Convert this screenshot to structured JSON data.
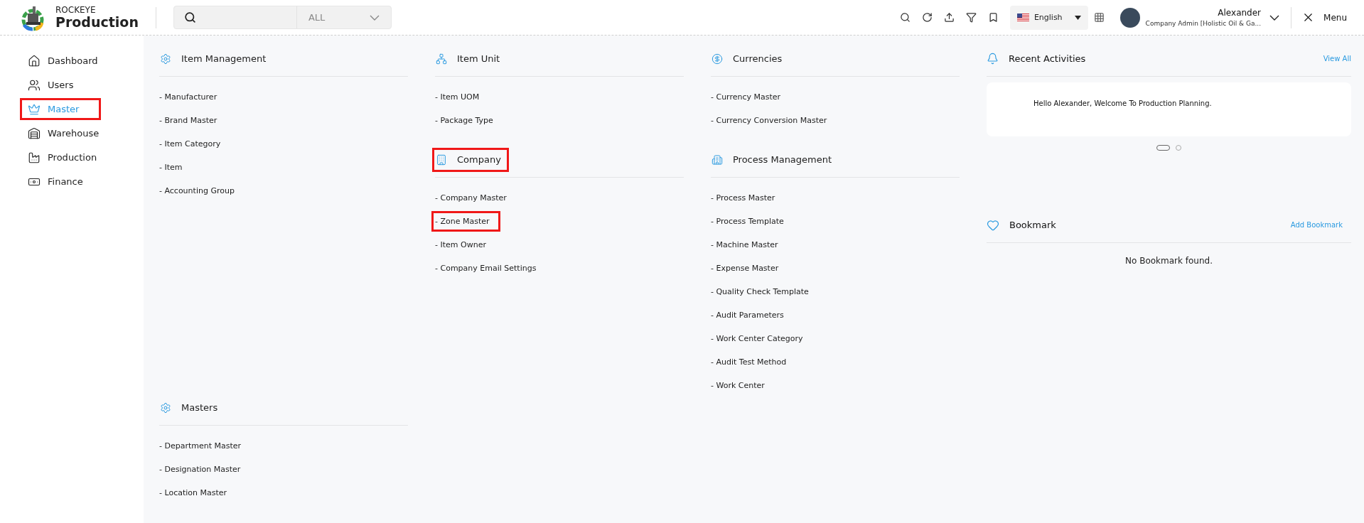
{
  "header": {
    "brand_top": "ROCKEYE",
    "brand_name": "Production",
    "search": {
      "scope": "ALL"
    },
    "language": "English",
    "user": {
      "name": "Alexander",
      "role": "Company Admin [Holistic Oil & Ga..."
    },
    "menu_label": "Menu"
  },
  "sidebar": {
    "items": [
      {
        "kind": "home",
        "label": "Dashboard",
        "selected": false,
        "highlighted": false
      },
      {
        "kind": "users",
        "label": "Users",
        "selected": false,
        "highlighted": false
      },
      {
        "kind": "crown",
        "label": "Master",
        "selected": true,
        "highlighted": true
      },
      {
        "kind": "warehouse",
        "label": "Warehouse",
        "selected": false,
        "highlighted": false
      },
      {
        "kind": "factory",
        "label": "Production",
        "selected": false,
        "highlighted": false
      },
      {
        "kind": "money",
        "label": "Finance",
        "selected": false,
        "highlighted": false
      }
    ]
  },
  "columns": [
    [
      {
        "kind": "gear",
        "title": "Item Management",
        "highlighted": false,
        "links": [
          {
            "label": "- Manufacturer",
            "highlighted": false
          },
          {
            "label": "- Brand Master",
            "highlighted": false
          },
          {
            "label": "- Item Category",
            "highlighted": false
          },
          {
            "label": "- Item",
            "highlighted": false
          },
          {
            "label": "- Accounting Group",
            "highlighted": false
          }
        ]
      },
      {
        "kind": "gear",
        "title": "Masters",
        "highlighted": false,
        "links": [
          {
            "label": "- Department Master",
            "highlighted": false
          },
          {
            "label": "- Designation Master",
            "highlighted": false
          },
          {
            "label": "- Location Master",
            "highlighted": false
          }
        ]
      }
    ],
    [
      {
        "kind": "units",
        "title": "Item Unit",
        "highlighted": false,
        "links": [
          {
            "label": "- Item UOM",
            "highlighted": false
          },
          {
            "label": "- Package Type",
            "highlighted": false
          }
        ]
      },
      {
        "kind": "building",
        "title": "Company",
        "highlighted": true,
        "links": [
          {
            "label": "- Company Master",
            "highlighted": false
          },
          {
            "label": "- Zone Master",
            "highlighted": true
          },
          {
            "label": "- Item Owner",
            "highlighted": false
          },
          {
            "label": "- Company Email Settings",
            "highlighted": false
          }
        ]
      }
    ],
    [
      {
        "kind": "dollar",
        "title": "Currencies",
        "highlighted": false,
        "links": [
          {
            "label": "- Currency Master",
            "highlighted": false
          },
          {
            "label": "- Currency Conversion Master",
            "highlighted": false
          }
        ]
      },
      {
        "kind": "city",
        "title": "Process Management",
        "highlighted": false,
        "links": [
          {
            "label": "- Process Master",
            "highlighted": false
          },
          {
            "label": "- Process Template",
            "highlighted": false
          },
          {
            "label": "- Machine Master",
            "highlighted": false
          },
          {
            "label": "- Expense Master",
            "highlighted": false
          },
          {
            "label": "- Quality Check Template",
            "highlighted": false
          },
          {
            "label": "- Audit Parameters",
            "highlighted": false
          },
          {
            "label": "- Work Center Category",
            "highlighted": false
          },
          {
            "label": "- Audit Test Method",
            "highlighted": false
          },
          {
            "label": "- Work Center",
            "highlighted": false
          }
        ]
      }
    ]
  ],
  "recent_activities": {
    "title": "Recent Activities",
    "action": "View All",
    "message": "Hello Alexander, Welcome To Production Planning.",
    "dots": [
      {
        "selected": true
      },
      {
        "selected": false
      }
    ]
  },
  "bookmark": {
    "title": "Bookmark",
    "action": "Add Bookmark",
    "empty": "No Bookmark found."
  }
}
